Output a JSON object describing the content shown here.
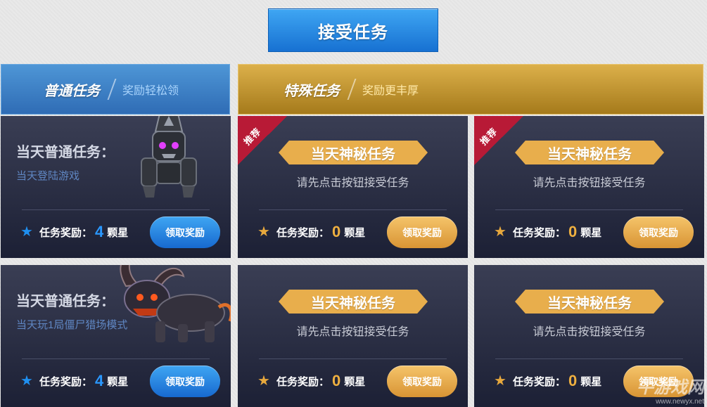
{
  "accept_button": "接受任务",
  "normal_header": {
    "title": "普通任务",
    "subtitle": "奖励轻松领"
  },
  "special_header": {
    "title": "特殊任务",
    "subtitle": "奖励更丰厚"
  },
  "normal_tasks": [
    {
      "title": "当天普通任务：",
      "desc": "当天登陆游戏",
      "reward_label": "任务奖励：",
      "reward_value": "4",
      "reward_unit": "颗星",
      "button": "领取奖励"
    },
    {
      "title": "当天普通任务：",
      "desc": "当天玩1局僵尸猎场模式",
      "reward_label": "任务奖励：",
      "reward_value": "4",
      "reward_unit": "颗星",
      "button": "领取奖励"
    }
  ],
  "special_tasks": [
    {
      "ribbon": "推荐",
      "banner": "当天神秘任务",
      "desc": "请先点击按钮接受任务",
      "reward_label": "任务奖励：",
      "reward_value": "0",
      "reward_unit": "颗星",
      "button": "领取奖励"
    },
    {
      "ribbon": "推荐",
      "banner": "当天神秘任务",
      "desc": "请先点击按钮接受任务",
      "reward_label": "任务奖励：",
      "reward_value": "0",
      "reward_unit": "颗星",
      "button": "领取奖励"
    },
    {
      "banner": "当天神秘任务",
      "desc": "请先点击按钮接受任务",
      "reward_label": "任务奖励：",
      "reward_value": "0",
      "reward_unit": "颗星",
      "button": "领取奖励"
    },
    {
      "banner": "当天神秘任务",
      "desc": "请先点击按钮接受任务",
      "reward_label": "任务奖励：",
      "reward_value": "0",
      "reward_unit": "颗星",
      "button": "领取奖励"
    }
  ],
  "watermark": {
    "main": "牛游戏网",
    "url": "www.newyx.net"
  },
  "colors": {
    "blue_accent": "#1f8ff0",
    "gold_accent": "#e7a83d",
    "card_bg": "#262a40",
    "ribbon": "#b81a36"
  },
  "icons": {
    "reward": "star-icon"
  }
}
